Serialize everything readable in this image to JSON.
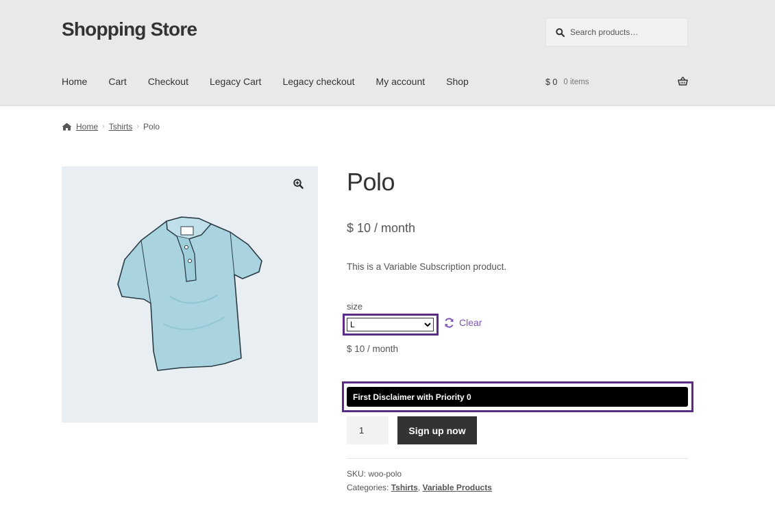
{
  "site": {
    "title": "Shopping Store"
  },
  "search": {
    "placeholder": "Search products…"
  },
  "nav": {
    "items": [
      {
        "label": "Home"
      },
      {
        "label": "Cart"
      },
      {
        "label": "Checkout"
      },
      {
        "label": "Legacy Cart"
      },
      {
        "label": "Legacy checkout"
      },
      {
        "label": "My account"
      },
      {
        "label": "Shop"
      }
    ]
  },
  "cart": {
    "amount": "$ 0",
    "items": "0 items"
  },
  "breadcrumb": {
    "home": "Home",
    "category": "Tshirts",
    "current": "Polo"
  },
  "product": {
    "title": "Polo",
    "price": "$ 10 / month",
    "description": "This is a Variable Subscription product.",
    "size_label": "size",
    "size_selected": "L",
    "clear_label": "Clear",
    "variation_price": "$ 10 / month",
    "disclaimer": "First Disclaimer with Priority 0",
    "quantity": "1",
    "signup_label": "Sign up now",
    "sku_label": "SKU:",
    "sku_value": "woo-polo",
    "categories_label": "Categories:",
    "categories": [
      "Tshirts",
      "Variable Products"
    ],
    "category_separator": ","
  },
  "icons": {
    "search": "search-icon",
    "basket": "basket-icon",
    "home": "home-icon",
    "zoom": "zoom-in-icon",
    "refresh": "refresh-icon"
  },
  "colors": {
    "accent": "#7f54b3",
    "highlight_border": "#5b2a86",
    "button_bg": "#333333",
    "header_bg": "#e9e9e9"
  }
}
